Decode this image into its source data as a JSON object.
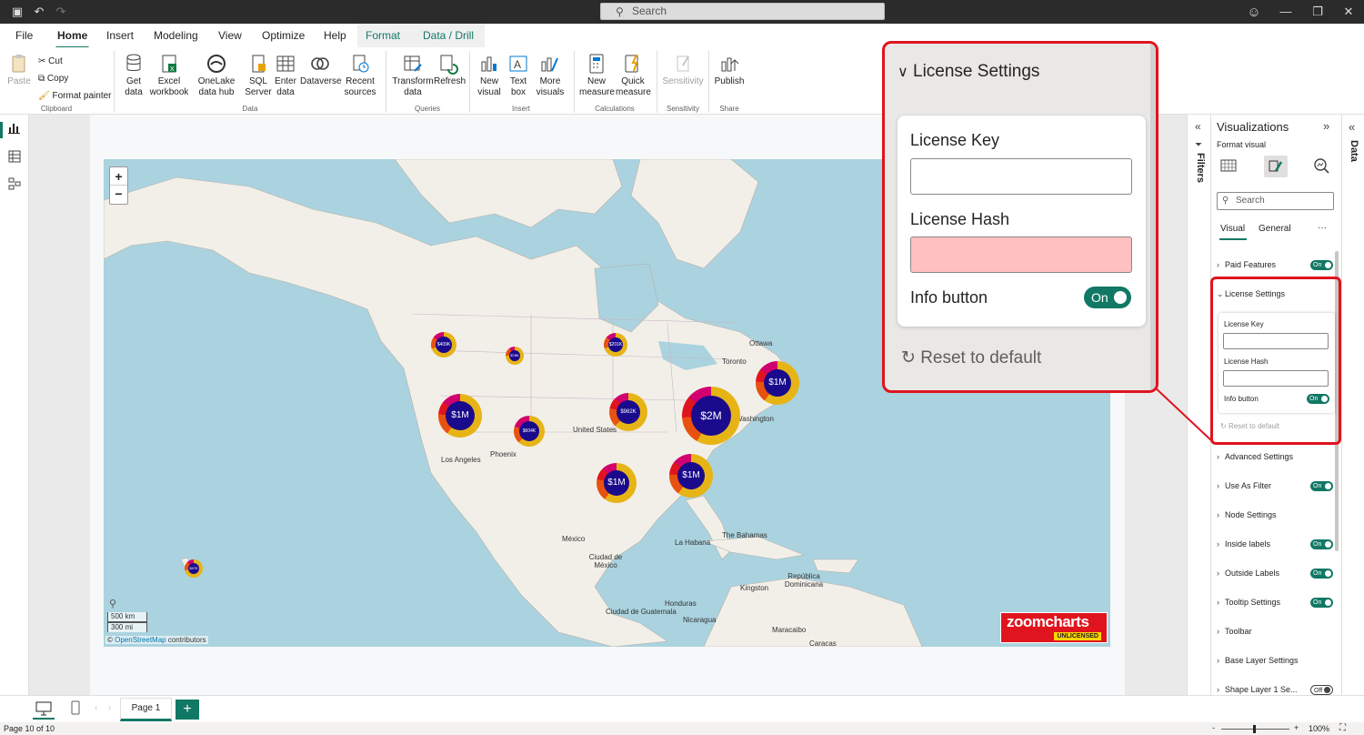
{
  "titlebar": {
    "search_placeholder": "Search"
  },
  "menu": {
    "tabs": [
      "File",
      "Home",
      "Insert",
      "Modeling",
      "View",
      "Optimize",
      "Help",
      "Format",
      "Data / Drill"
    ]
  },
  "ribbon": {
    "clipboard": {
      "paste": "Paste",
      "cut": "Cut",
      "copy": "Copy",
      "format_painter": "Format painter",
      "group": "Clipboard"
    },
    "data": {
      "get_data": "Get data",
      "excel": "Excel workbook",
      "onelake": "OneLake data hub",
      "sql": "SQL Server",
      "enter": "Enter data",
      "dataverse": "Dataverse",
      "recent": "Recent sources",
      "group": "Data"
    },
    "queries": {
      "transform": "Transform data",
      "refresh": "Refresh",
      "group": "Queries"
    },
    "insert": {
      "new_visual": "New visual",
      "text_box": "Text box",
      "more_visuals": "More visuals",
      "group": "Insert"
    },
    "calculations": {
      "new_measure": "New measure",
      "quick_measure": "Quick measure",
      "group": "Calculations"
    },
    "sensitivity": {
      "label": "Sensitivity",
      "group": "Sensitivity"
    },
    "share": {
      "publish": "Publish",
      "group": "Share"
    }
  },
  "map": {
    "zoom_in": "+",
    "zoom_out": "−",
    "labels": [
      "Ottawa",
      "Toronto",
      "Washington",
      "United States",
      "Phoenix",
      "Los Angeles",
      "México",
      "Ciudad de México",
      "La Habana",
      "The Bahamas",
      "República Dominicana",
      "Kingston",
      "Ciudad de Guatemala",
      "Honduras",
      "Nicaragua",
      "Maracaibo",
      "Caracas"
    ],
    "bubbles": [
      "$409K",
      "$78K",
      "$201K",
      "$1M",
      "$604K",
      "$982K",
      "$2M",
      "$1M",
      "$1M",
      "$1M",
      "$47K"
    ],
    "scale_km": "500 km",
    "scale_mi": "300 mi",
    "attribution_prefix": "© ",
    "attribution_link": "OpenStreetMap",
    "attribution_suffix": " contributors",
    "logo_text": "zoomcharts",
    "logo_badge": "UNLICENSED"
  },
  "pages": {
    "current": "Page 1",
    "add": "+"
  },
  "status": {
    "page_info": "Page 10 of 10",
    "zoom": "100%",
    "minus": "-",
    "plus": "+"
  },
  "filters": {
    "title": "Filters"
  },
  "data_pane": {
    "title": "Data"
  },
  "viz": {
    "title": "Visualizations",
    "subtitle": "Format visual",
    "search_placeholder": "Search",
    "tabs": [
      "Visual",
      "General"
    ],
    "more": "···",
    "sections": [
      {
        "label": "Paid Features",
        "toggle": "On"
      },
      {
        "label": "License Settings"
      },
      {
        "label": "Advanced Settings"
      },
      {
        "label": "Use As Filter",
        "toggle": "On"
      },
      {
        "label": "Node Settings"
      },
      {
        "label": "Inside labels",
        "toggle": "On"
      },
      {
        "label": "Outside Labels",
        "toggle": "On"
      },
      {
        "label": "Tooltip Settings",
        "toggle": "On"
      },
      {
        "label": "Toolbar"
      },
      {
        "label": "Base Layer Settings"
      },
      {
        "label": "Shape Layer 1 Se...",
        "toggle": "Off"
      }
    ],
    "license": {
      "key_label": "License Key",
      "hash_label": "License Hash",
      "info_label": "Info button",
      "info_toggle": "On",
      "reset": "Reset to default"
    }
  },
  "zoom_panel": {
    "header": "License Settings",
    "key_label": "License Key",
    "hash_label": "License Hash",
    "info_label": "Info button",
    "info_toggle": "On",
    "reset": "Reset to default"
  },
  "colors": {
    "accent": "#117865",
    "highlight": "#e0141e",
    "hash_fill": "#ffc0c0",
    "bubble_core": "#1a0a8c",
    "bubble_ring": "#e7b416"
  }
}
